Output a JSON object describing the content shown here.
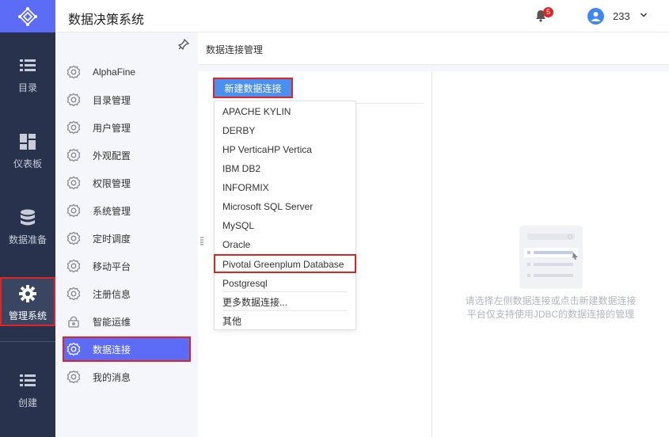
{
  "app": {
    "title": "数据决策系统"
  },
  "header": {
    "notification_count": "5",
    "username": "233"
  },
  "rail": {
    "items": [
      {
        "label": "目录",
        "icon": "list-icon"
      },
      {
        "label": "仪表板",
        "icon": "dashboard-icon"
      },
      {
        "label": "数据准备",
        "icon": "database-icon"
      },
      {
        "label": "管理系统",
        "icon": "gear-icon"
      },
      {
        "label": "创建",
        "icon": "create-list-icon"
      }
    ]
  },
  "subnav": {
    "items": [
      {
        "label": "AlphaFine"
      },
      {
        "label": "目录管理"
      },
      {
        "label": "用户管理"
      },
      {
        "label": "外观配置"
      },
      {
        "label": "权限管理"
      },
      {
        "label": "系统管理"
      },
      {
        "label": "定时调度"
      },
      {
        "label": "移动平台"
      },
      {
        "label": "注册信息"
      },
      {
        "label": "智能运维"
      },
      {
        "label": "数据连接"
      },
      {
        "label": "我的消息"
      }
    ]
  },
  "main": {
    "title": "数据连接管理",
    "new_button": "新建数据连接",
    "dropdown": [
      "APACHE KYLIN",
      "DERBY",
      "HP VerticaHP Vertica",
      "IBM DB2",
      "INFORMIX",
      "Microsoft SQL Server",
      "MySQL",
      "Oracle",
      "Pivotal Greenplum Database",
      "Postgresql",
      "更多数据连接...",
      "其他"
    ],
    "empty_line1": "请选择左侧数据连接或点击新建数据连接",
    "empty_line2": "平台仅支持使用JDBC的数据连接的管理"
  },
  "colors": {
    "rail": "#28324c",
    "accent": "#5c6cf6",
    "button": "#4a90f0",
    "highlight": "#e02424"
  }
}
